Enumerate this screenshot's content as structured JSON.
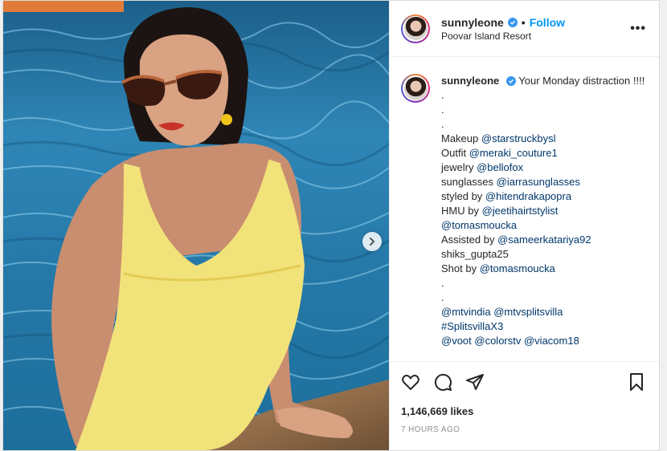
{
  "post": {
    "username": "sunnyleone",
    "follow_label": "Follow",
    "separator": "•",
    "location": "Poovar Island Resort",
    "more_label": "•••"
  },
  "caption": {
    "username": "sunnyleone",
    "text": "Your Monday distraction !!!!",
    "lines": [
      {
        "pre": ".",
        "mention": ""
      },
      {
        "pre": ".",
        "mention": ""
      },
      {
        "pre": ".",
        "mention": ""
      },
      {
        "pre": "Makeup ",
        "mention": "@starstruckbysl"
      },
      {
        "pre": "Outfit ",
        "mention": "@meraki_couture1"
      },
      {
        "pre": "jewelry ",
        "mention": "@bellofox"
      },
      {
        "pre": "sunglasses ",
        "mention": "@iarrasunglasses"
      },
      {
        "pre": "styled by ",
        "mention": "@hitendrakapopra"
      },
      {
        "pre": "HMU by ",
        "mention": "@jeetihairtstylist"
      },
      {
        "pre": "",
        "mention": "@tomasmoucka"
      },
      {
        "pre": "Assisted by ",
        "mention": "@sameerkatariya92"
      },
      {
        "pre": "shiks_gupta25",
        "mention": ""
      },
      {
        "pre": "Shot by ",
        "mention": "@tomasmoucka"
      },
      {
        "pre": ".",
        "mention": ""
      },
      {
        "pre": ".",
        "mention": ""
      },
      {
        "pre": "",
        "mention": "@mtvindia @mtvsplitsvilla"
      },
      {
        "pre": "",
        "mention": "#SplitsvillaX3"
      },
      {
        "pre": "",
        "mention": "@voot @colorstv @viacom18"
      }
    ]
  },
  "stats": {
    "likes": "1,146,669 likes",
    "time": "7 HOURS AGO"
  },
  "colors": {
    "accent": "#0095f6",
    "verified": "#3897f0",
    "mention": "#00376b"
  },
  "icons": [
    "verified-badge-icon",
    "heart-icon",
    "comment-icon",
    "share-icon",
    "bookmark-icon",
    "chevron-right-icon",
    "more-icon"
  ]
}
